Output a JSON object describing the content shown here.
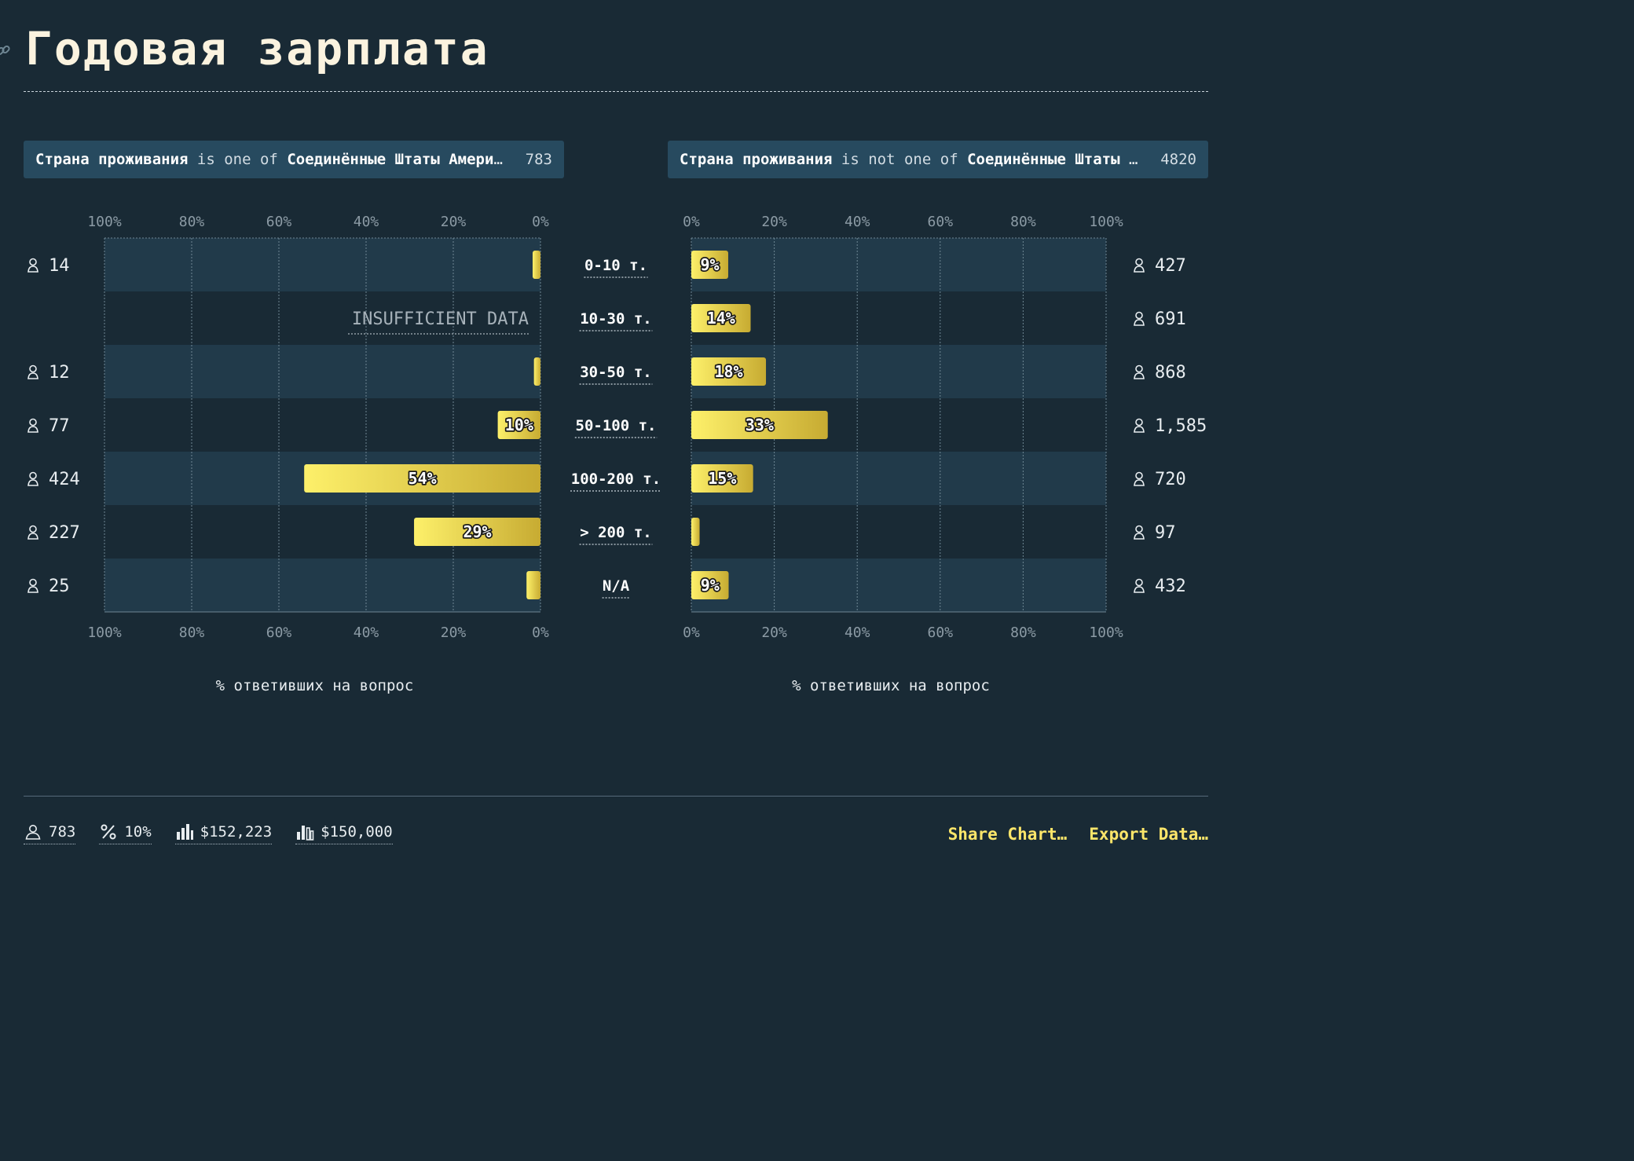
{
  "title": "Годовая зарплата",
  "filters": {
    "left": {
      "field": "Страна проживания",
      "op": "is one of",
      "value": "Соединённые Штаты Америки",
      "count": "783"
    },
    "right": {
      "field": "Страна проживания",
      "op": "is not one of",
      "value": "Соединённые Штаты Америки",
      "count": "4820"
    }
  },
  "colors": {
    "bg": "#192a35",
    "band": "#213a4a",
    "bar_start": "#fdf06a",
    "bar_end": "#c7ab32",
    "grid": "#6f8794",
    "tick": "#8c9ba5"
  },
  "chart_data": {
    "type": "bar",
    "orientation": "horizontal",
    "categories": [
      "0-10 т.",
      "10-30 т.",
      "30-50 т.",
      "50-100 т.",
      "100-200 т.",
      "> 200 т.",
      "N/A"
    ],
    "xlabel": "% ответивших на вопрос",
    "xlim": [
      0,
      100
    ],
    "ticks": [
      "0%",
      "20%",
      "40%",
      "60%",
      "80%",
      "100%"
    ],
    "grid": true,
    "series": [
      {
        "side": "left",
        "values": [
          1.8,
          null,
          1.5,
          9.8,
          54.2,
          29.0,
          3.2
        ],
        "labels": [
          "",
          "INSUFFICIENT DATA",
          "",
          "10%",
          "54%",
          "29%",
          ""
        ],
        "counts": [
          "14",
          "",
          "12",
          "77",
          "424",
          "227",
          "25"
        ]
      },
      {
        "side": "right",
        "values": [
          8.9,
          14.3,
          18.0,
          32.9,
          14.9,
          2.0,
          9.0
        ],
        "labels": [
          "9%",
          "14%",
          "18%",
          "33%",
          "15%",
          "",
          "9%"
        ],
        "counts": [
          "427",
          "691",
          "868",
          "1,585",
          "720",
          "97",
          "432"
        ]
      }
    ]
  },
  "stats": [
    {
      "icon": "person-icon",
      "value": "783"
    },
    {
      "icon": "percent-icon",
      "value": "10%"
    },
    {
      "icon": "bar-chart-icon",
      "value": "$152,223"
    },
    {
      "icon": "bar-chart-median-icon",
      "value": "$150,000"
    }
  ],
  "actions": {
    "share": "Share Chart…",
    "export": "Export Data…"
  }
}
